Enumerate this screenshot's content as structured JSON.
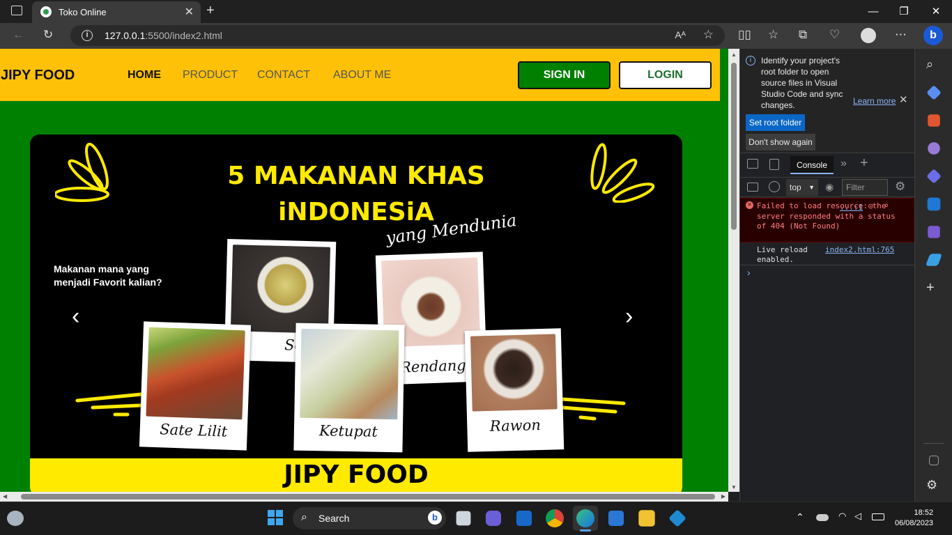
{
  "browser": {
    "tab_title": "Toko Online",
    "url_host": "127.0.0.1",
    "url_rest": ":5500/index2.html"
  },
  "site": {
    "logo": "JIPY FOOD",
    "nav": [
      "HOME",
      "PRODUCT",
      "CONTACT",
      "ABOUT ME"
    ],
    "signin_label": "SIGN IN",
    "login_label": "LOGIN",
    "banner": {
      "title_line1": "5 MAKANAN KHAS",
      "title_line2": "iNDONESiA",
      "subtitle": "yang Mendunia",
      "question_line1": "Makanan mana yang",
      "question_line2": "menjadi Favorit kalian?",
      "foods": [
        "Soto",
        "Rendang",
        "Sate Lilit",
        "Ketupat",
        "Rawon"
      ],
      "footer": "JIPY FOOD"
    }
  },
  "devtools": {
    "info_text": "Identify your project's root folder to open source files in Visual Studio Code and sync changes.",
    "learn_more": "Learn more",
    "set_root": "Set root folder",
    "dont_show": "Don't show again",
    "tab_console": "Console",
    "context": "top",
    "filter_placeholder": "Filter",
    "error_text": "Failed to load resource: the server responded with a status of 404 (Not Found)",
    "error_link": "...:1",
    "log_text": "Live reload enabled.",
    "log_link": "index2.html:765"
  },
  "taskbar": {
    "search": "Search",
    "time": "18:52",
    "date": "06/08/2023"
  }
}
